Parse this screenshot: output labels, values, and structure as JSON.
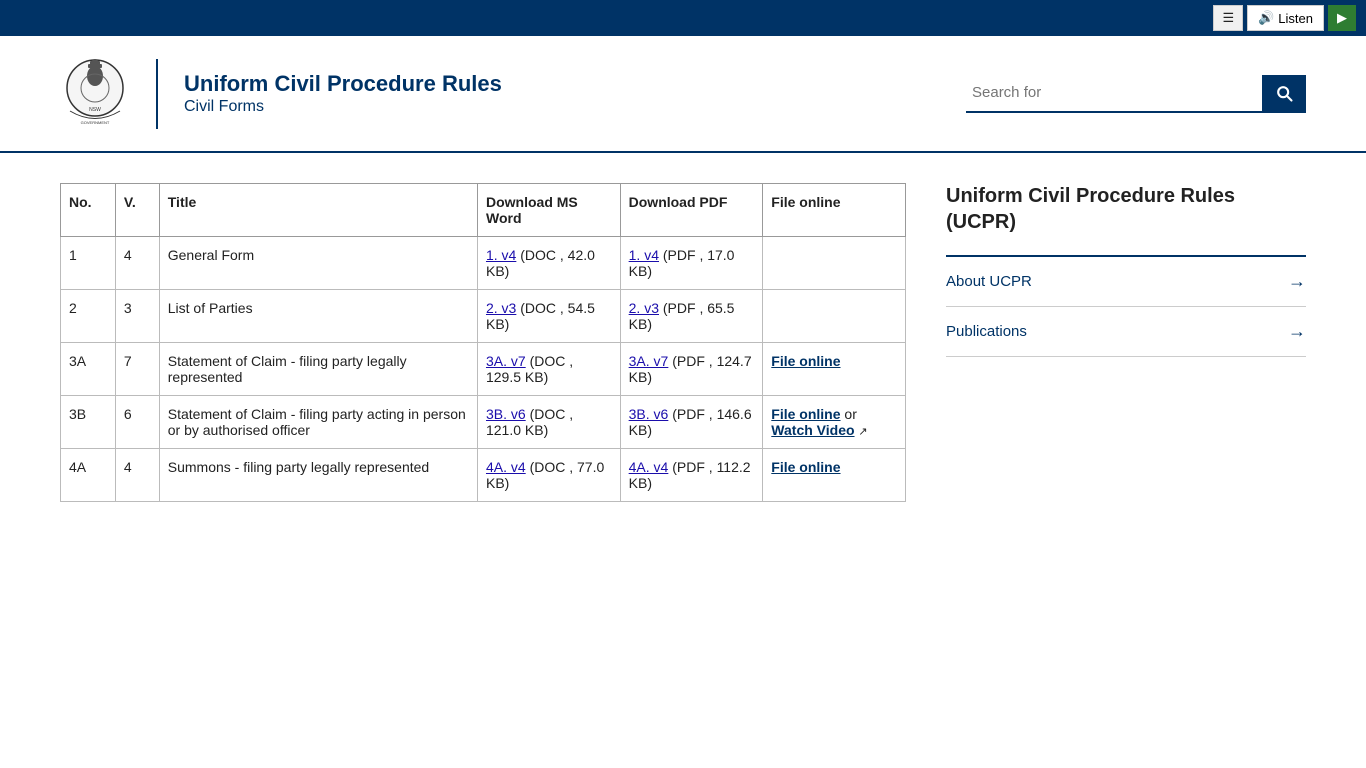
{
  "topbar": {
    "menu_label": "≡",
    "listen_label": "Listen",
    "play_label": "▶"
  },
  "header": {
    "title_line1": "Uniform Civil Procedure Rules",
    "title_line2": "Civil Forms",
    "search_placeholder": "Search for"
  },
  "table": {
    "columns": [
      "No.",
      "V.",
      "Title",
      "Download MS Word",
      "Download PDF",
      "File online"
    ],
    "rows": [
      {
        "no": "1",
        "v": "4",
        "title": "General Form",
        "dl_word_link": "1. v4",
        "dl_word_meta": "(DOC , 42.0 KB)",
        "dl_pdf_link": "1. v4",
        "dl_pdf_meta": "(PDF , 17.0 KB)",
        "file_online": ""
      },
      {
        "no": "2",
        "v": "3",
        "title": "List of Parties",
        "dl_word_link": "2. v3",
        "dl_word_meta": "(DOC , 54.5 KB)",
        "dl_pdf_link": "2. v3",
        "dl_pdf_meta": "(PDF , 65.5 KB)",
        "file_online": ""
      },
      {
        "no": "3A",
        "v": "7",
        "title": "Statement of Claim - filing party legally represented",
        "dl_word_link": "3A. v7",
        "dl_word_meta": "(DOC , 129.5 KB)",
        "dl_pdf_link": "3A. v7",
        "dl_pdf_meta": "(PDF , 124.7 KB)",
        "file_online": "File online"
      },
      {
        "no": "3B",
        "v": "6",
        "title": "Statement of Claim - filing party acting in person or by authorised officer",
        "dl_word_link": "3B. v6",
        "dl_word_meta": "(DOC , 121.0 KB)",
        "dl_pdf_link": "3B. v6",
        "dl_pdf_meta": "(PDF , 146.6 KB)",
        "file_online": "File online",
        "watch_video": "Watch Video"
      },
      {
        "no": "4A",
        "v": "4",
        "title": "Summons - filing party legally represented",
        "dl_word_link": "4A. v4",
        "dl_word_meta": "(DOC , 77.0 KB)",
        "dl_pdf_link": "4A. v4",
        "dl_pdf_meta": "(PDF , 112.2 KB)",
        "file_online": "File online"
      }
    ]
  },
  "sidebar": {
    "title": "Uniform Civil Procedure Rules (UCPR)",
    "links": [
      {
        "label": "About UCPR"
      },
      {
        "label": "Publications"
      }
    ]
  }
}
